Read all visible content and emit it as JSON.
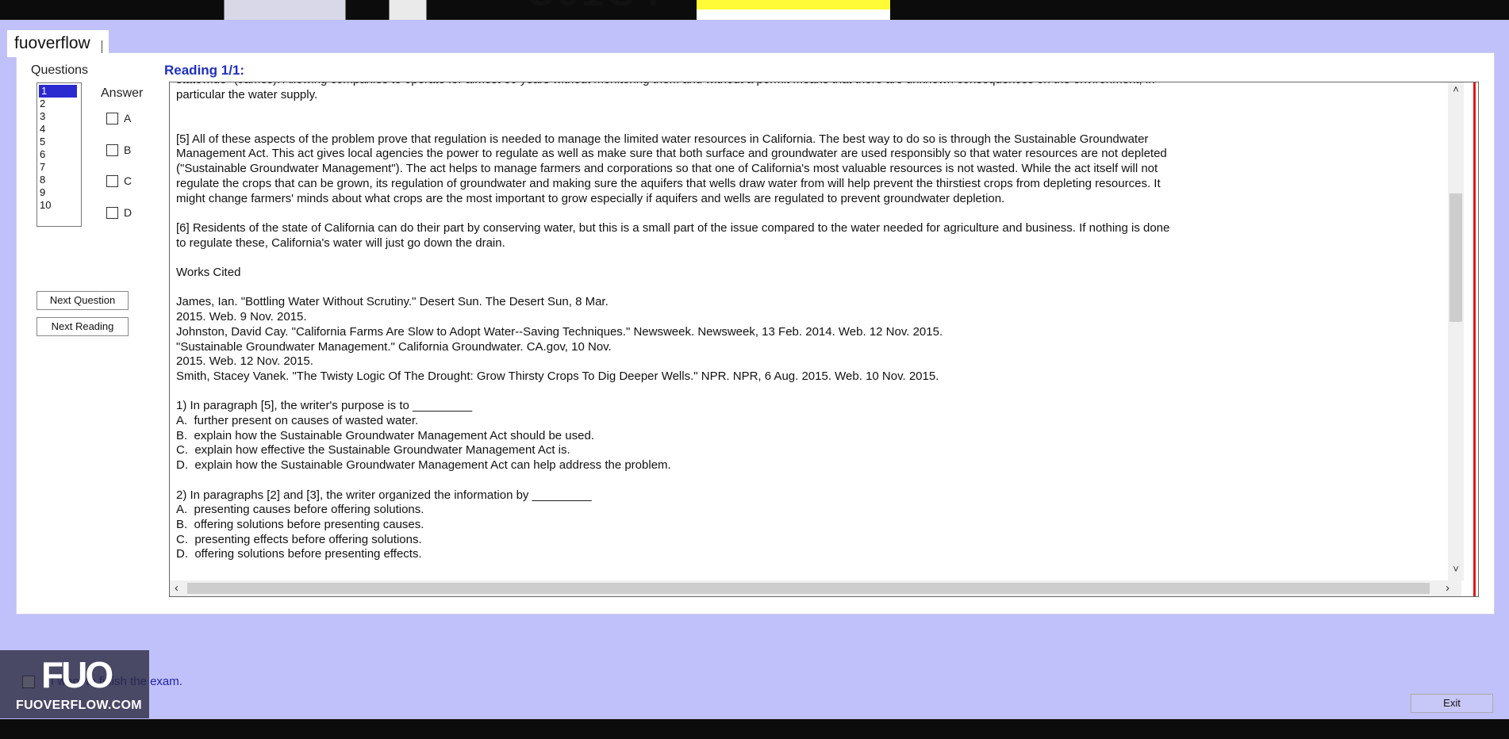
{
  "watermark_text": "fuoverflow",
  "questions": {
    "title": "Questions",
    "items": [
      "1",
      "2",
      "3",
      "4",
      "5",
      "6",
      "7",
      "8",
      "9",
      "10"
    ],
    "selected": "1"
  },
  "answer": {
    "title": "Answer",
    "options": [
      "A",
      "B",
      "C",
      "D"
    ]
  },
  "buttons": {
    "next_question": "Next Question",
    "next_reading": "Next Reading",
    "exit": "Exit"
  },
  "reading": {
    "title": "Reading 1/1",
    "colon": ":",
    "paragraphs": [
      "statewide\" (James). Allowing companies to operate for almost 30 years without monitoring them and without a permit means that there are unknown consequences on the environment, in\nparticular the water supply.",
      "",
      "",
      "[5] All of these aspects of the problem prove that regulation is needed to manage the limited water resources in California. The best way to do so is through the Sustainable Groundwater\nManagement Act. This act gives local agencies the power to regulate as well as make sure that both surface and groundwater are used responsibly so that water resources are not depleted\n(\"Sustainable Groundwater Management\"). The act helps to manage farmers and corporations so that one of California's most valuable resources is not wasted. While the act itself will not\nregulate the crops that can be grown, its regulation of groundwater and making sure the aquifers that wells draw water from will help prevent the thirstiest crops from depleting resources. It\nmight change farmers' minds about what crops are the most important to grow especially if aquifers and wells are regulated to prevent groundwater depletion.",
      "",
      "[6] Residents of the state of California can do their part by conserving water, but this is a small part of the issue compared to the water needed for agriculture and business. If nothing is done\nto regulate these, California's water will just go down the drain.",
      "",
      "Works Cited",
      "",
      "James, Ian. \"Bottling Water Without Scrutiny.\" Desert Sun. The Desert Sun, 8 Mar.\n2015. Web. 9 Nov. 2015.\nJohnston, David Cay. \"California Farms Are Slow to Adopt Water--Saving Techniques.\" Newsweek. Newsweek, 13 Feb. 2014. Web. 12 Nov. 2015.\n\"Sustainable Groundwater Management.\" California Groundwater. CA.gov, 10 Nov.\n2015. Web. 12 Nov. 2015.\nSmith, Stacey Vanek. \"The Twisty Logic Of The Drought: Grow Thirsty Crops To Dig Deeper Wells.\" NPR. NPR, 6 Aug. 2015. Web. 10 Nov. 2015.",
      "",
      "1) In paragraph [5], the writer's purpose is to _________\nA.  further present on causes of wasted water.\nB.  explain how the Sustainable Groundwater Management Act should be used.\nC.  explain how effective the Sustainable Groundwater Management Act is.\nD.  explain how the Sustainable Groundwater Management Act can help address the problem.",
      "",
      "2) In paragraphs [2] and [3], the writer organized the information by _________\nA.  presenting causes before offering solutions.\nB.  offering solutions before presenting causes.\nC.  presenting effects before offering solutions.\nD.  offering solutions before presenting effects."
    ]
  },
  "finish": {
    "label": "I want to finish the exam."
  },
  "logo": {
    "big": "FUO",
    "small": "FUOVERFLOW.COM"
  },
  "scroll_arrows": {
    "up": "˄",
    "down": "˅",
    "left": "‹",
    "right": "›"
  }
}
